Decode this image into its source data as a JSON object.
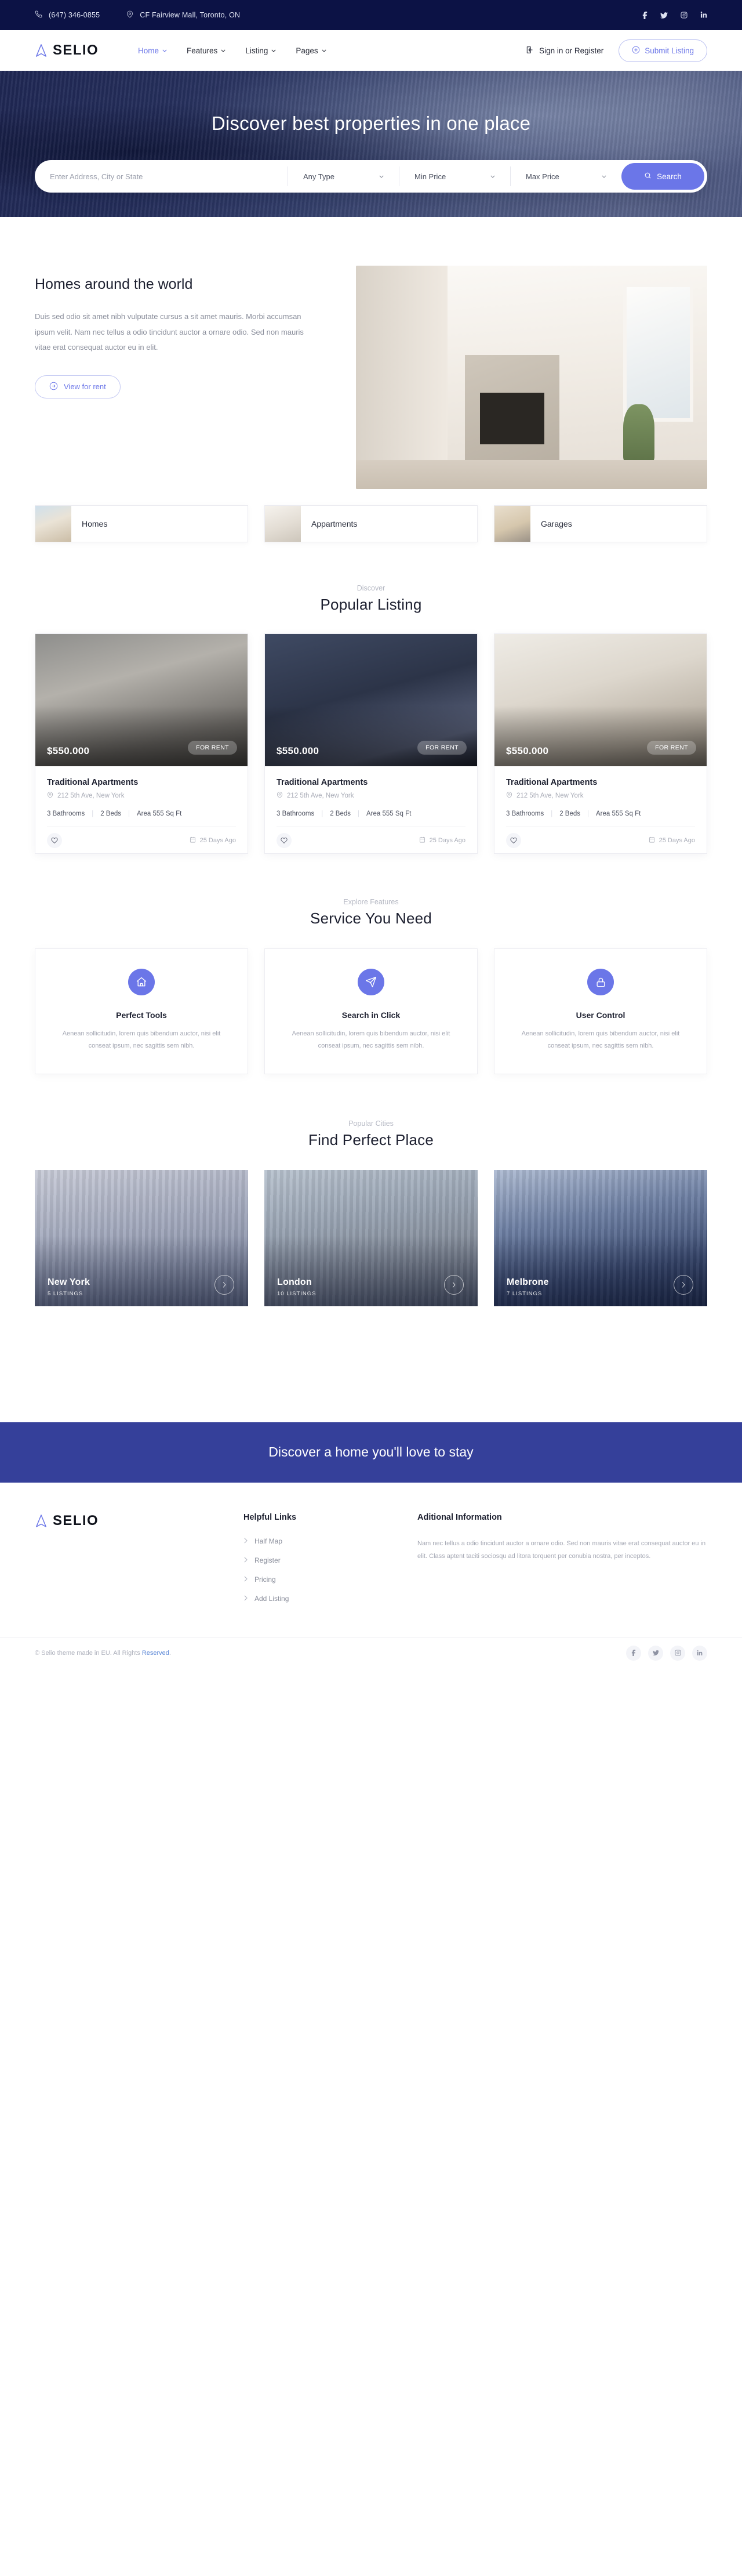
{
  "topbar": {
    "phone": "(647) 346-0855",
    "address": "CF Fairview Mall, Toronto, ON",
    "social": [
      "facebook",
      "twitter",
      "instagram",
      "linkedin"
    ]
  },
  "nav": {
    "brand": "SELIO",
    "links": [
      {
        "label": "Home",
        "active": true
      },
      {
        "label": "Features",
        "active": false
      },
      {
        "label": "Listing",
        "active": false
      },
      {
        "label": "Pages",
        "active": false
      }
    ],
    "signin": "Sign in or Register",
    "submit": "Submit Listing"
  },
  "hero": {
    "title": "Discover best properties in one place",
    "search": {
      "address_placeholder": "Enter Address, City or State",
      "type": "Any Type",
      "min_price": "Min Price",
      "max_price": "Max Price",
      "button": "Search"
    }
  },
  "about": {
    "heading": "Homes around the world",
    "paragraph": "Duis sed odio sit amet nibh vulputate cursus a sit amet mauris. Morbi accumsan ipsum velit. Nam nec tellus a odio tincidunt auctor a ornare odio. Sed non mauris vitae erat consequat auctor eu in elit.",
    "button": "View for rent"
  },
  "categories": [
    {
      "label": "Homes"
    },
    {
      "label": "Appartments"
    },
    {
      "label": "Garages"
    }
  ],
  "listings": {
    "eyebrow": "Discover",
    "title": "Popular Listing",
    "cards": [
      {
        "price": "$550.000",
        "tag": "FOR RENT",
        "title": "Traditional Apartments",
        "address": "212 5th Ave, New York",
        "bathrooms": "3 Bathrooms",
        "beds": "2 Beds",
        "area": "Area 555 Sq Ft",
        "ago": "25 Days Ago"
      },
      {
        "price": "$550.000",
        "tag": "FOR RENT",
        "title": "Traditional Apartments",
        "address": "212 5th Ave, New York",
        "bathrooms": "3 Bathrooms",
        "beds": "2 Beds",
        "area": "Area 555 Sq Ft",
        "ago": "25 Days Ago"
      },
      {
        "price": "$550.000",
        "tag": "FOR RENT",
        "title": "Traditional Apartments",
        "address": "212 5th Ave, New York",
        "bathrooms": "3 Bathrooms",
        "beds": "2 Beds",
        "area": "Area 555 Sq Ft",
        "ago": "25 Days Ago"
      }
    ]
  },
  "services": {
    "eyebrow": "Explore Features",
    "title": "Service You Need",
    "cards": [
      {
        "icon": "home-icon",
        "title": "Perfect Tools",
        "desc": "Aenean sollicitudin, lorem quis bibendum auctor, nisi elit conseat ipsum, nec sagittis sem nibh."
      },
      {
        "icon": "send-icon",
        "title": "Search in Click",
        "desc": "Aenean sollicitudin, lorem quis bibendum auctor, nisi elit conseat ipsum, nec sagittis sem nibh."
      },
      {
        "icon": "lock-icon",
        "title": "User Control",
        "desc": "Aenean sollicitudin, lorem quis bibendum auctor, nisi elit conseat ipsum, nec sagittis sem nibh."
      }
    ]
  },
  "cities": {
    "eyebrow": "Popular Cities",
    "title": "Find Perfect Place",
    "cards": [
      {
        "name": "New York",
        "count": "5 LISTINGS"
      },
      {
        "name": "London",
        "count": "10 LISTINGS"
      },
      {
        "name": "Melbrone",
        "count": "7 LISTINGS"
      }
    ]
  },
  "cta": {
    "text": "Discover a home you'll love to stay"
  },
  "footer": {
    "brand": "SELIO",
    "links_heading": "Helpful Links",
    "links": [
      {
        "label": "Half Map"
      },
      {
        "label": "Register"
      },
      {
        "label": "Pricing"
      },
      {
        "label": "Add Listing"
      }
    ],
    "info_heading": "Aditional Information",
    "info_text": "Nam nec tellus a odio tincidunt auctor a ornare odio. Sed non mauris vitae erat consequat auctor eu in elit. Class aptent taciti sociosqu ad litora torquent per conubia nostra, per inceptos.",
    "copyright_before": "© Selio theme made in EU. All Rights ",
    "copyright_link": "Reserved",
    "copyright_after": ".",
    "social": [
      "facebook",
      "twitter",
      "instagram",
      "linkedin"
    ]
  },
  "colors": {
    "brand_purple": "#6b76e8",
    "dark_navy": "#0c1245",
    "cta_blue": "#35409a"
  }
}
